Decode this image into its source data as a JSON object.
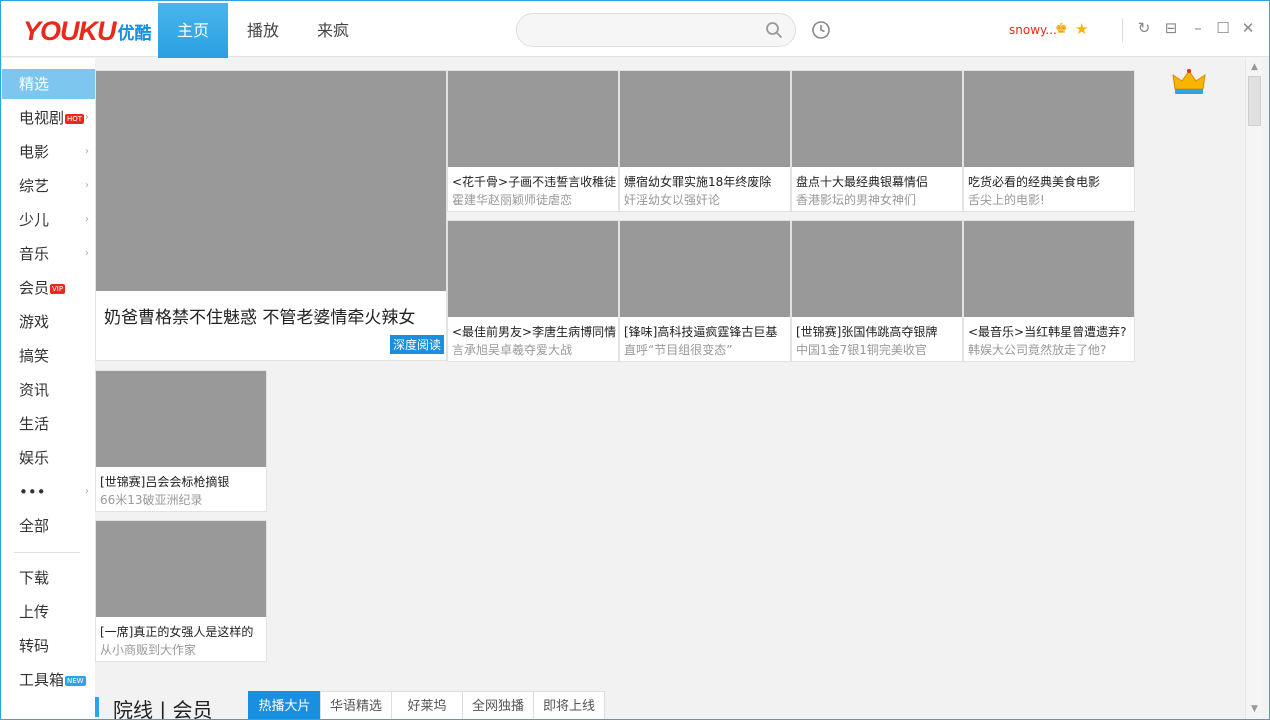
{
  "header": {
    "logo_text": "YOUKU",
    "logo_cn": "优酷",
    "tabs": [
      {
        "label": "主页"
      },
      {
        "label": "播放"
      },
      {
        "label": "来疯"
      }
    ],
    "search": {
      "placeholder": ""
    },
    "user": {
      "name": "snowy..."
    }
  },
  "sidebar": {
    "items": [
      {
        "label": "精选",
        "active": true
      },
      {
        "label": "电视剧",
        "tag": "HOT"
      },
      {
        "label": "电影"
      },
      {
        "label": "综艺"
      },
      {
        "label": "少儿"
      },
      {
        "label": "音乐"
      },
      {
        "label": "会员",
        "tag": "VIP"
      },
      {
        "label": "游戏"
      },
      {
        "label": "搞笑"
      },
      {
        "label": "资讯"
      },
      {
        "label": "生活"
      },
      {
        "label": "娱乐"
      },
      {
        "label": "•••"
      },
      {
        "label": "全部"
      },
      {
        "label": "下载"
      },
      {
        "label": "上传"
      },
      {
        "label": "转码"
      },
      {
        "label": "工具箱",
        "tag": "NEW"
      }
    ]
  },
  "hero": {
    "title": "奶爸曹格禁不住魅惑 不管老婆情牵火辣女",
    "button": "深度阅读"
  },
  "cards": [
    {
      "title": "<花千骨>子画不违誓言收稚徒",
      "sub": "霍建华赵丽颖师徒虐恋"
    },
    {
      "title": "嫖宿幼女罪实施18年终废除",
      "sub": "奸淫幼女以强奸论"
    },
    {
      "title": "盘点十大最经典银幕情侣",
      "sub": "香港影坛的男神女神们"
    },
    {
      "title": "吃货必看的经典美食电影",
      "sub": "舌尖上的电影!"
    },
    {
      "title": "<最佳前男友>李唐生病博同情",
      "sub": "言承旭吴卓羲夺爱大战"
    },
    {
      "title": "[锋味]高科技逼疯霆锋古巨基",
      "sub": "直呼“节目组很变态”"
    },
    {
      "title": "[世锦赛]张国伟跳高夺银牌",
      "sub": "中国1金7银1铜完美收官"
    },
    {
      "title": "<最音乐>当红韩星曾遭遗弃?",
      "sub": "韩娱大公司竟然放走了他?"
    },
    {
      "title": "[世锦赛]吕会会标枪摘银",
      "sub": "66米13破亚洲纪录"
    },
    {
      "title": "[一席]真正的女强人是这样的",
      "sub": "从小商贩到大作家"
    }
  ],
  "section": {
    "title": "院线 | 会员",
    "tabs": [
      {
        "label": "热播大片",
        "active": true
      },
      {
        "label": "华语精选"
      },
      {
        "label": "好莱坞"
      },
      {
        "label": "全网独播"
      },
      {
        "label": "即将上线"
      }
    ]
  },
  "colors": {
    "accent": "#2aa6e6",
    "thumb_placeholder": "#999999",
    "brand_red": "#e8291b"
  }
}
